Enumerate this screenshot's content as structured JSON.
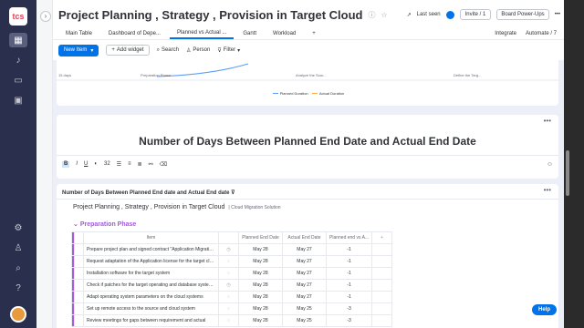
{
  "app": {
    "logo_text": "tcs"
  },
  "header": {
    "title": "Project Planning , Strategy , Provision in Target Cloud",
    "last_seen": "Last seen",
    "invite": "Invite / 1",
    "board_powerups": "Board Power-Ups",
    "more": "•••"
  },
  "tabs": [
    {
      "label": "Main Table"
    },
    {
      "label": "Dashboard of Depe..."
    },
    {
      "label": "Planned vs Actual ..."
    },
    {
      "label": "Gantt"
    },
    {
      "label": "Workload"
    },
    {
      "label": "+"
    }
  ],
  "tabs_right": {
    "integrate": "Integrate",
    "automate": "Automate / 7"
  },
  "toolbar": {
    "new_item": "New Item",
    "add_widget": "Add widget",
    "search": "Search",
    "person": "Person",
    "filter": "Filter"
  },
  "chart_widget": {
    "axis_min": "15 days",
    "x_labels": [
      "Preparation Phase",
      "Analyze the Sour...",
      "Define the Targ..."
    ],
    "legend": [
      "Planned Duration",
      "Actual Duration"
    ]
  },
  "text_widget": {
    "title": "Number of Days Between Planned End Date and Actual End Date",
    "font_size": "32"
  },
  "table_widget": {
    "title": "Number of Days Between Planned End date and Actual End date",
    "board_title": "Project Planning , Strategy , Provision in Target Cloud",
    "workspace": "Cloud Migration Solution",
    "group": "Preparation Phase",
    "columns": [
      "Item",
      "Planned End Date",
      "Actual End Date",
      "Planned end vs A..."
    ],
    "rows": [
      {
        "item": "Prepare project plan and signed contract \"Application Migration...",
        "planned": "May 28",
        "actual": "May 27",
        "diff": "-1"
      },
      {
        "item": "Request adaptation of the Application license for the target clou...",
        "planned": "May 28",
        "actual": "May 27",
        "diff": "-1"
      },
      {
        "item": "Installation software for the target system",
        "planned": "May 28",
        "actual": "May 27",
        "diff": "-1"
      },
      {
        "item": "Check if patches for the target operating and database system ...",
        "planned": "May 28",
        "actual": "May 27",
        "diff": "-1"
      },
      {
        "item": "Adapt operating system parameters on the cloud systems",
        "planned": "May 28",
        "actual": "May 27",
        "diff": "-1"
      },
      {
        "item": "Set up remote access to the source and cloud system",
        "planned": "May 28",
        "actual": "May 25",
        "diff": "-3"
      },
      {
        "item": "Review meetings for gaps between requirement and actual",
        "planned": "May 28",
        "actual": "May 25",
        "diff": "-3"
      }
    ]
  },
  "help": "Help",
  "colors": {
    "accent": "#0073ea",
    "group": "#a25ddc",
    "rail": "#292f4c"
  }
}
